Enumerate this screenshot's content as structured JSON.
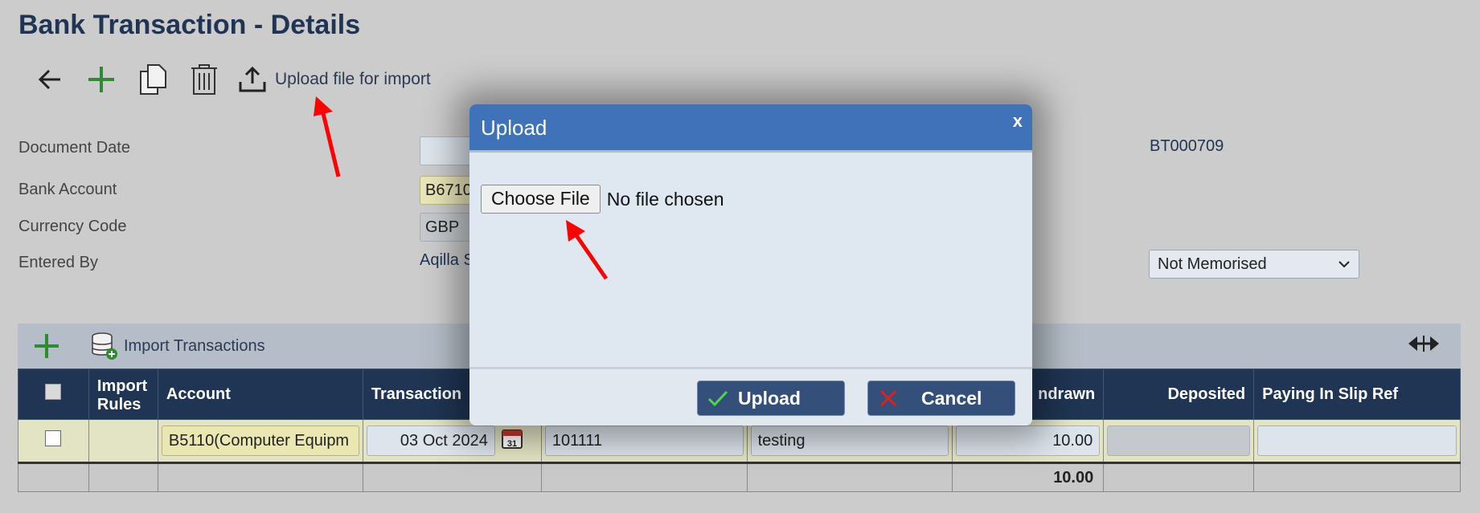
{
  "page": {
    "title": "Bank Transaction - Details"
  },
  "toolbar": {
    "upload_label": "Upload file for import"
  },
  "form": {
    "document_date_label": "Document Date",
    "bank_account_label": "Bank Account",
    "bank_account_value": "B6710",
    "currency_code_label": "Currency Code",
    "currency_code_value": "GBP",
    "entered_by_label": "Entered By",
    "entered_by_value": "Aqilla S",
    "document_number": "BT000709",
    "memorise_select": "Not Memorised"
  },
  "grid_toolbar": {
    "import_label": "Import Transactions"
  },
  "grid": {
    "headers": [
      "Import Rules",
      "Account",
      "Transaction",
      "ndrawn",
      "Deposited",
      "Paying In Slip Ref"
    ],
    "row": {
      "account": "B5110(Computer Equipm",
      "date": "03 Oct 2024",
      "calendar_day": "31",
      "reference": "101111",
      "description": "testing",
      "withdrawn": "10.00",
      "deposited": "",
      "paying_in_slip_ref": ""
    },
    "total_withdrawn": "10.00"
  },
  "modal": {
    "title": "Upload",
    "close": "x",
    "choose_file": "Choose File",
    "no_file": "No file chosen",
    "upload_button": "Upload",
    "cancel_button": "Cancel"
  },
  "colors": {
    "header_navy": "#1f3553",
    "modal_header": "#3f72b8",
    "accent_green": "#2e8b2e",
    "annotation_red": "#ff0000"
  }
}
